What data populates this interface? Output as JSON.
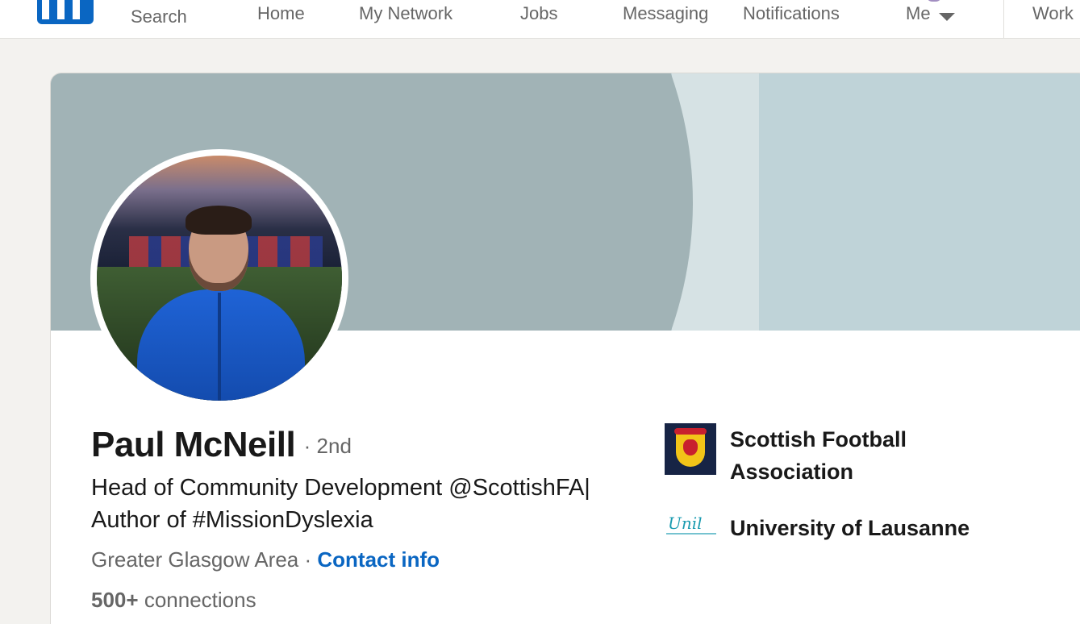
{
  "nav": {
    "search_label": "Search",
    "home_label": "Home",
    "network_label": "My Network",
    "jobs_label": "Jobs",
    "messaging_label": "Messaging",
    "notifications_label": "Notifications",
    "me_label": "Me",
    "work_label": "Work"
  },
  "profile": {
    "name": "Paul McNeill",
    "degree": "· 2nd",
    "headline": "Head of Community Development @ScottishFA| Author of #MissionDyslexia",
    "location": "Greater Glasgow Area",
    "separator": "·",
    "contact_info_label": "Contact info",
    "connections_count": "500+",
    "connections_label": "connections"
  },
  "organizations": [
    {
      "name": "Scottish Football Association",
      "logo": "scottish-fa-logo"
    },
    {
      "name": "University of Lausanne",
      "logo": "unil-logo"
    }
  ],
  "colors": {
    "brand": "#0a66c2",
    "banner_light": "#bfd3d8",
    "banner_dark": "#a1b3b6",
    "page_bg": "#f3f2ef"
  }
}
